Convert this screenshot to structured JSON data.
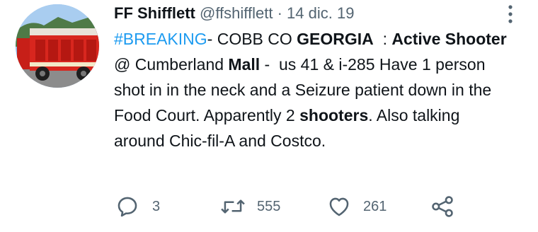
{
  "tweet": {
    "display_name": "FF Shifflett",
    "handle": "@ffshifflett",
    "separator": "·",
    "date": "14 dic. 19",
    "body": [
      {
        "text": "#BREAKING",
        "style": "hashtag"
      },
      {
        "text": "- COBB CO ",
        "style": "normal"
      },
      {
        "text": "GEORGIA",
        "style": "bold"
      },
      {
        "text": "  : ",
        "style": "normal"
      },
      {
        "text": "Active Shooter",
        "style": "bold"
      },
      {
        "text": " @ Cumberland ",
        "style": "normal"
      },
      {
        "text": "Mall",
        "style": "bold"
      },
      {
        "text": " -  us 41 & i-285 Have 1 person shot in in the neck and a Seizure patient down in the  Food Court. Apparently 2 ",
        "style": "normal"
      },
      {
        "text": "shooters",
        "style": "bold"
      },
      {
        "text": ". Also talking around Chic-fil-A and Costco.",
        "style": "normal"
      }
    ]
  },
  "actions": {
    "reply_count": "3",
    "retweet_count": "555",
    "like_count": "261"
  },
  "colors": {
    "text": "#0f1419",
    "secondary": "#536471",
    "hashtag": "#1d9bf0"
  },
  "icons": {
    "avatar": "fire-truck-photo",
    "more": "more-dots-vertical-icon",
    "reply": "reply-icon",
    "retweet": "retweet-icon",
    "like": "heart-icon",
    "share": "share-icon"
  }
}
